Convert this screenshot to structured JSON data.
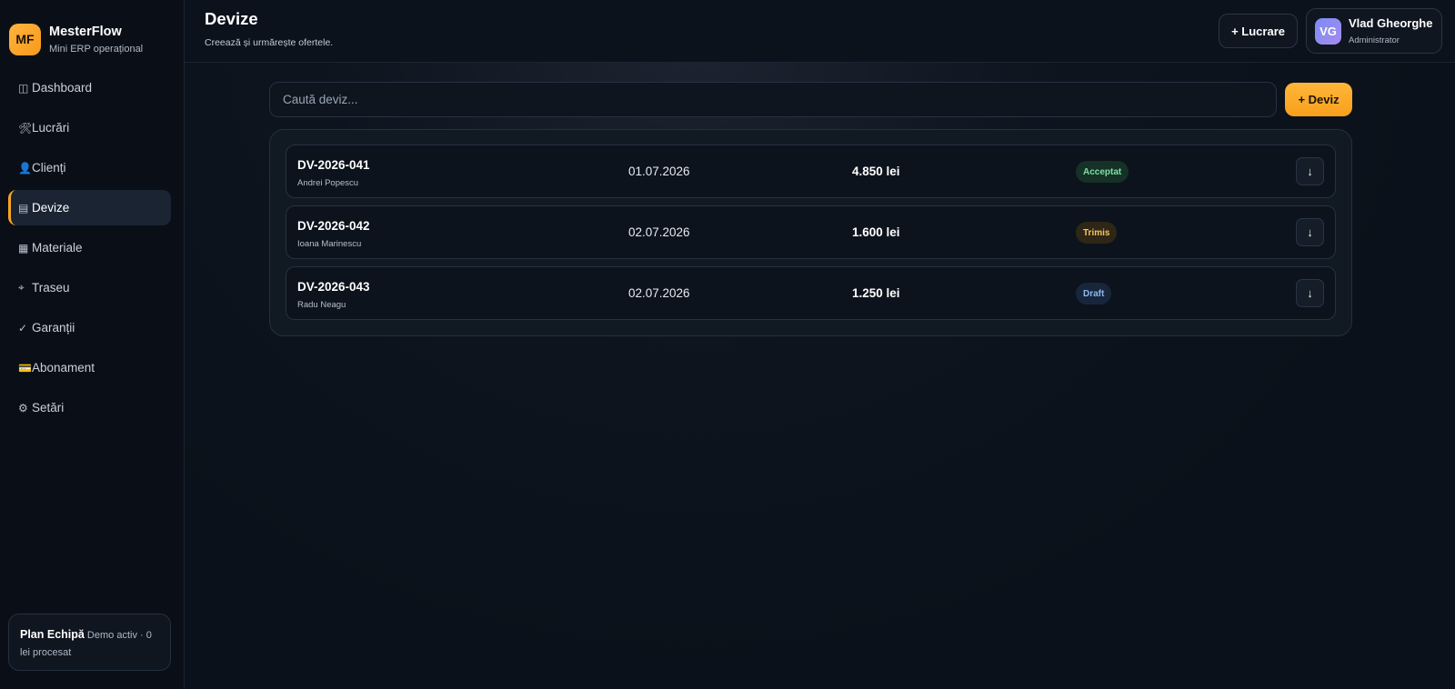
{
  "brand": {
    "logo": "MF",
    "name": "MesterFlow",
    "subtitle": "Mini ERP operațional"
  },
  "sidebar": {
    "items": [
      {
        "icon": "◫",
        "label": "Dashboard",
        "active": false
      },
      {
        "icon": "🛠",
        "label": "Lucrări",
        "active": false
      },
      {
        "icon": "👤",
        "label": "Clienți",
        "active": false
      },
      {
        "icon": "▤",
        "label": "Devize",
        "active": true
      },
      {
        "icon": "▦",
        "label": "Materiale",
        "active": false
      },
      {
        "icon": "⌖",
        "label": "Traseu",
        "active": false
      },
      {
        "icon": "✓",
        "label": "Garanții",
        "active": false
      },
      {
        "icon": "💳",
        "label": "Abonament",
        "active": false
      },
      {
        "icon": "⚙",
        "label": "Setări",
        "active": false
      }
    ],
    "plan": {
      "title": "Plan Echipă",
      "text": "Demo activ · 0 lei procesat"
    }
  },
  "header": {
    "title": "Devize",
    "subtitle": "Creează și urmărește ofertele.",
    "new_work_label": "+ Lucrare"
  },
  "user": {
    "initials": "VG",
    "name": "Vlad Gheorghe",
    "role": "Administrator"
  },
  "search": {
    "placeholder": "Caută deviz..."
  },
  "add_quote_label": "+ Deviz",
  "quotes": [
    {
      "id": "DV-2026-041",
      "client": "Andrei Popescu",
      "date": "01.07.2026",
      "amount": "4.850 lei",
      "status": "Acceptat",
      "status_color": "#7de0a5",
      "action_icon": "↓"
    },
    {
      "id": "DV-2026-042",
      "client": "Ioana Marinescu",
      "date": "02.07.2026",
      "amount": "1.600 lei",
      "status": "Trimis",
      "status_color": "#f7c55f",
      "action_icon": "↓"
    },
    {
      "id": "DV-2026-043",
      "client": "Radu Neagu",
      "date": "02.07.2026",
      "amount": "1.250 lei",
      "status": "Draft",
      "status_color": "#8fb8ef",
      "action_icon": "↓"
    }
  ],
  "colors": {
    "accent": "#f7a01c",
    "background": "#0b111a",
    "sidebar_active": "#1a2433"
  }
}
